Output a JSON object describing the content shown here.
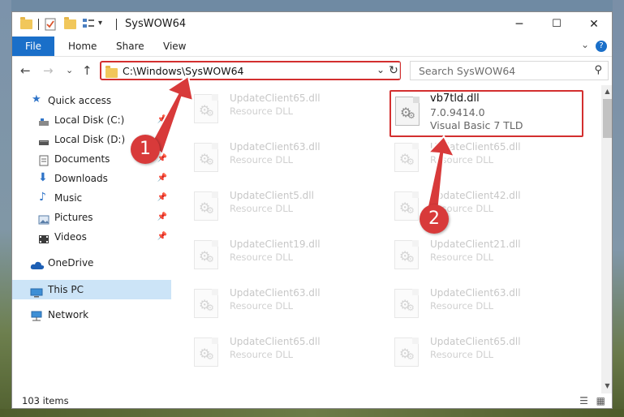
{
  "window": {
    "title": "SysWOW64",
    "controls": {
      "minimize": "─",
      "maximize": "☐",
      "close": "✕"
    }
  },
  "ribbon": {
    "tabs": [
      "File",
      "Home",
      "Share",
      "View"
    ],
    "expand_chevron": "⌄",
    "help": "?"
  },
  "address": {
    "path": "C:\\Windows\\SysWOW64",
    "search_placeholder": "Search SysWOW64",
    "back": "←",
    "forward": "→",
    "recent": "⌄",
    "up": "↑",
    "refresh": "↻"
  },
  "sidebar": {
    "items": [
      {
        "label": "Quick access",
        "icon": "star-icon"
      },
      {
        "label": "Local Disk (C:)",
        "icon": "drive-icon"
      },
      {
        "label": "Local Disk (D:)",
        "icon": "drive-icon"
      },
      {
        "label": "Documents",
        "icon": "documents-icon"
      },
      {
        "label": "Downloads",
        "icon": "download-icon"
      },
      {
        "label": "Music",
        "icon": "music-icon"
      },
      {
        "label": "Pictures",
        "icon": "pictures-icon"
      },
      {
        "label": "Videos",
        "icon": "videos-icon"
      },
      {
        "label": "OneDrive",
        "icon": "cloud-icon"
      },
      {
        "label": "This PC",
        "icon": "computer-icon"
      },
      {
        "label": "Network",
        "icon": "network-icon"
      }
    ]
  },
  "files": {
    "left": [
      {
        "name": "UpdateClient65.dll",
        "type": "Resource DLL"
      },
      {
        "name": "UpdateClient63.dll",
        "type": "Resource DLL"
      },
      {
        "name": "UpdateClient5.dll",
        "type": "Resource DLL"
      },
      {
        "name": "UpdateClient19.dll",
        "type": "Resource DLL"
      },
      {
        "name": "UpdateClient63.dll",
        "type": "Resource DLL"
      },
      {
        "name": "UpdateClient65.dll",
        "type": "Resource DLL"
      }
    ],
    "right": [
      {
        "name": "vb7tld.dll",
        "version": "7.0.9414.0",
        "type": "Visual Basic 7 TLD"
      },
      {
        "name": "UpdateClient65.dll",
        "type": "Resource DLL"
      },
      {
        "name": "UpdateClient42.dll",
        "type": "Resource DLL"
      },
      {
        "name": "UpdateClient21.dll",
        "type": "Resource DLL"
      },
      {
        "name": "UpdateClient63.dll",
        "type": "Resource DLL"
      },
      {
        "name": "UpdateClient65.dll",
        "type": "Resource DLL"
      }
    ]
  },
  "status": {
    "count": "103 items"
  },
  "annotations": {
    "badge1": "1",
    "badge2": "2",
    "color": "#d83a3a"
  },
  "colors": {
    "accent": "#1a6fc9",
    "highlight_box": "#d32f2f",
    "selected": "#cce4f7"
  }
}
